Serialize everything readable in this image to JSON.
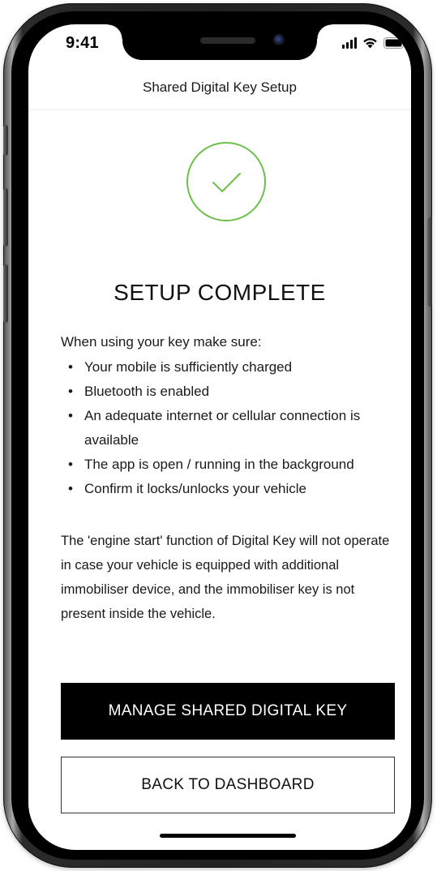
{
  "status_bar": {
    "time": "9:41",
    "icons": [
      "signal-icon",
      "wifi-icon",
      "battery-icon"
    ]
  },
  "header": {
    "title": "Shared Digital Key Setup"
  },
  "main": {
    "status_icon": "checkmark-circle-icon",
    "accent_color": "#6cc04a",
    "title": "SETUP COMPLETE",
    "intro": "When using your key make sure:",
    "bullet_glyph": "•",
    "tips": [
      "Your mobile is sufficiently charged",
      "Bluetooth is enabled",
      "An adequate internet or cellular connection is available",
      "The app is open / running in the background",
      "Confirm it locks/unlocks your vehicle"
    ],
    "note": "The 'engine start' function of Digital Key will not operate in case your vehicle is equipped with additional immobiliser device, and the immobiliser key is not present inside the vehicle."
  },
  "actions": {
    "primary_label": "MANAGE SHARED DIGITAL KEY",
    "secondary_label": "BACK TO DASHBOARD"
  }
}
